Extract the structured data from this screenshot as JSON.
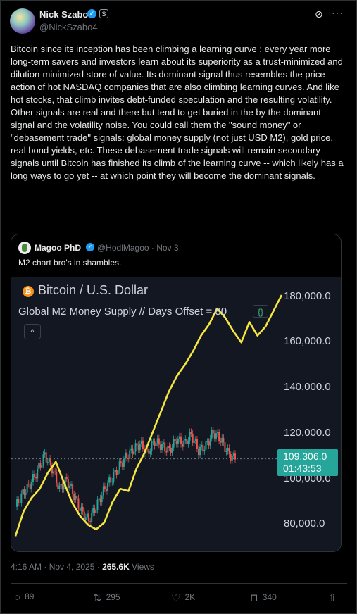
{
  "author": {
    "name": "Nick Szabo",
    "handle": "@NickSzabo4",
    "affiliate_badge": "$"
  },
  "tweet_text": "Bitcoin since its inception has been climbing a learning curve : every year more long-term savers and investors learn about its superiority as a trust-minimized and dilution-minimized store of value.  Its dominant signal thus resembles the price action of hot NASDAQ companies that are also climbing learning curves.  And like hot stocks, that climb invites debt-funded speculation and the resulting volatility. Other signals are real and there but tend to get buried in the by the dominant signal and the volatility noise.  You could call them the \"sound money\" or \"debasement trade\" signals: global money supply (not just USD M2), gold price, real bond yields, etc.   These debasement trade signals will remain secondary signals until Bitcoin has finished its climb of the learning curve -- which likely has a long ways to go yet -- at which point they will become the dominant signals.",
  "quote": {
    "name": "Magoo PhD",
    "handle_date": "@HodlMagoo · Nov 3",
    "text": "M2 chart bro's in shambles."
  },
  "chart": {
    "title": "Bitcoin / U.S. Dollar",
    "subtitle": "Global M2 Money Supply // Days Offset = 80",
    "subtitle_icon": "{}",
    "collapse_icon": "^",
    "y_ticks": [
      "180,000.0",
      "160,000.0",
      "140,000.0",
      "120,000.0",
      "100,000.0",
      "80,000.0"
    ],
    "price_label": "109,306.0",
    "countdown": "01:43:53",
    "colors": {
      "m2_line": "#f5e642",
      "candle_up": "#26a69a",
      "candle_down": "#ef5350",
      "background": "#131722"
    }
  },
  "chart_data": {
    "type": "line",
    "title": "Bitcoin / U.S. Dollar",
    "subtitle": "Global M2 Money Supply // Days Offset = 80",
    "ylim": [
      72000,
      187000
    ],
    "series": [
      {
        "name": "Global M2 Money Supply",
        "values": [
          75000,
          86000,
          92000,
          96000,
          103000,
          108000,
          99000,
          90000,
          84000,
          80000,
          78000,
          81000,
          90000,
          96000,
          95000,
          105000,
          112000,
          121000,
          130000,
          139000,
          146000,
          151000,
          157000,
          164000,
          169000,
          176000,
          172000,
          166000,
          161000,
          170000,
          164000,
          168000,
          175000,
          182000
        ]
      },
      {
        "values": [
          88000,
          94000,
          98000,
          104000,
          111000,
          105000,
          96000,
          100000,
          93000,
          86000,
          82000,
          88000,
          95000,
          100000,
          105000,
          110000,
          113000,
          116000,
          112000,
          117000,
          115000,
          113000,
          118000,
          116000,
          120000,
          113000,
          115000,
          121000,
          118000,
          112000,
          109000
        ]
      }
    ]
  },
  "meta": {
    "time": "4:16 AM · Nov 4, 2025 · ",
    "views_count": "265.6K",
    "views_label": " Views"
  },
  "actions": {
    "replies": "89",
    "reposts": "295",
    "likes": "2K",
    "bookmarks": "340"
  }
}
